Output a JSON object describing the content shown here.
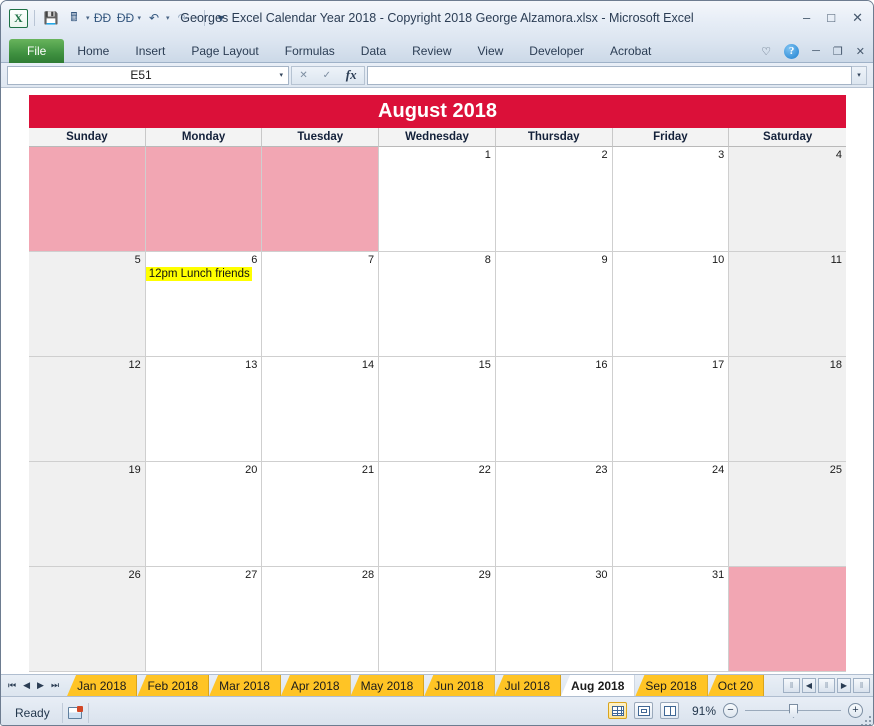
{
  "window": {
    "title": "Georges Excel Calendar Year 2018  -  Copyright 2018 George Alzamora.xlsx  -  Microsoft Excel",
    "minimize": "–",
    "restore": "□",
    "close": "✕"
  },
  "quick_access": {
    "excel_logo": "X",
    "items": [
      {
        "name": "save-icon",
        "glyph": "💾"
      },
      {
        "name": "print-preview-icon",
        "glyph": "🖩"
      },
      {
        "name": "find-icon",
        "glyph": "ÐÐ"
      },
      {
        "name": "find-next-icon",
        "glyph": "ÐÐ"
      },
      {
        "name": "undo-icon",
        "glyph": "↶"
      },
      {
        "name": "redo-icon",
        "glyph": "↷"
      },
      {
        "name": "customize-quick-access-icon",
        "glyph": "▾"
      }
    ]
  },
  "ribbon": {
    "tabs": [
      {
        "label": "File"
      },
      {
        "label": "Home"
      },
      {
        "label": "Insert"
      },
      {
        "label": "Page Layout"
      },
      {
        "label": "Formulas"
      },
      {
        "label": "Data"
      },
      {
        "label": "Review"
      },
      {
        "label": "View"
      },
      {
        "label": "Developer"
      },
      {
        "label": "Acrobat"
      }
    ],
    "collapse_glyph": "♡",
    "help_glyph": "?",
    "minimize_ribbon": "─",
    "restore_window": "❐",
    "close_window": "✕"
  },
  "formula_bar": {
    "name_box_value": "E51",
    "name_box_caret": "▾",
    "cancel_glyph": "✕",
    "enter_glyph": "✓",
    "fx_glyph": "fx",
    "formula_value": "",
    "expand_glyph": "▾"
  },
  "calendar": {
    "title": "August 2018",
    "title_color": "#DB1039",
    "blocked_color": "#f2a6b3",
    "weekend_color": "#f0f0f0",
    "event_color": "#FFFF00",
    "day_names": [
      "Sunday",
      "Monday",
      "Tuesday",
      "Wednesday",
      "Thursday",
      "Friday",
      "Saturday"
    ],
    "weeks": [
      [
        {
          "day": "",
          "state": "blocked"
        },
        {
          "day": "",
          "state": "blocked"
        },
        {
          "day": "",
          "state": "blocked"
        },
        {
          "day": "1",
          "state": "normal"
        },
        {
          "day": "2",
          "state": "normal"
        },
        {
          "day": "3",
          "state": "normal"
        },
        {
          "day": "4",
          "state": "weekend"
        }
      ],
      [
        {
          "day": "5",
          "state": "weekend"
        },
        {
          "day": "6",
          "state": "normal",
          "event": "12pm Lunch friends"
        },
        {
          "day": "7",
          "state": "normal"
        },
        {
          "day": "8",
          "state": "normal"
        },
        {
          "day": "9",
          "state": "normal"
        },
        {
          "day": "10",
          "state": "normal"
        },
        {
          "day": "11",
          "state": "weekend"
        }
      ],
      [
        {
          "day": "12",
          "state": "weekend"
        },
        {
          "day": "13",
          "state": "normal"
        },
        {
          "day": "14",
          "state": "normal"
        },
        {
          "day": "15",
          "state": "normal"
        },
        {
          "day": "16",
          "state": "normal"
        },
        {
          "day": "17",
          "state": "normal"
        },
        {
          "day": "18",
          "state": "weekend"
        }
      ],
      [
        {
          "day": "19",
          "state": "weekend"
        },
        {
          "day": "20",
          "state": "normal"
        },
        {
          "day": "21",
          "state": "normal"
        },
        {
          "day": "22",
          "state": "normal"
        },
        {
          "day": "23",
          "state": "normal"
        },
        {
          "day": "24",
          "state": "normal"
        },
        {
          "day": "25",
          "state": "weekend"
        }
      ],
      [
        {
          "day": "26",
          "state": "weekend"
        },
        {
          "day": "27",
          "state": "normal"
        },
        {
          "day": "28",
          "state": "normal"
        },
        {
          "day": "29",
          "state": "normal"
        },
        {
          "day": "30",
          "state": "normal"
        },
        {
          "day": "31",
          "state": "normal"
        },
        {
          "day": "",
          "state": "blocked"
        }
      ]
    ]
  },
  "sheet_tabs": {
    "nav": [
      {
        "name": "first-sheet-button",
        "glyph": "⏮"
      },
      {
        "name": "previous-sheet-button",
        "glyph": "◀"
      },
      {
        "name": "next-sheet-button",
        "glyph": "▶"
      },
      {
        "name": "last-sheet-button",
        "glyph": "⏭"
      }
    ],
    "tabs": [
      {
        "label": "Jan 2018",
        "active": false
      },
      {
        "label": "Feb 2018",
        "active": false
      },
      {
        "label": "Mar 2018",
        "active": false
      },
      {
        "label": "Apr 2018",
        "active": false
      },
      {
        "label": "May 2018",
        "active": false
      },
      {
        "label": "Jun 2018",
        "active": false
      },
      {
        "label": "Jul 2018",
        "active": false
      },
      {
        "label": "Aug 2018",
        "active": true
      },
      {
        "label": "Sep 2018",
        "active": false
      },
      {
        "label": "Oct 20",
        "active": false
      }
    ],
    "active_tab_color": "#ffffff",
    "tab_color": "#FFC425",
    "scroll_left_glyph": "◀",
    "scroll_thumb_glyph": "‖",
    "scroll_right_glyph": "▶"
  },
  "status_bar": {
    "status_text": "Ready",
    "macro_icon": "record-macro-icon",
    "views": [
      {
        "name": "normal-view-button",
        "active": true
      },
      {
        "name": "page-layout-view-button",
        "active": false
      },
      {
        "name": "page-break-preview-button",
        "active": false
      }
    ],
    "zoom_percent": "91%",
    "zoom_out_glyph": "−",
    "zoom_in_glyph": "+"
  }
}
